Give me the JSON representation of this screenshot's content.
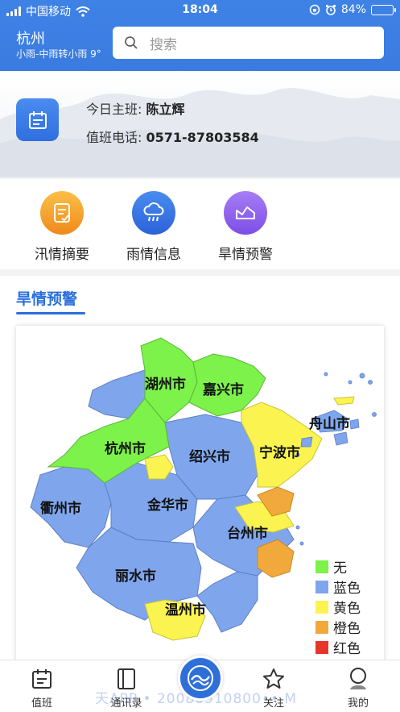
{
  "status_bar": {
    "carrier": "中国移动",
    "time": "18:04",
    "battery": "84%",
    "battery_level": 0.84
  },
  "header": {
    "city": "杭州",
    "weather": "小雨-中雨转小雨 9°",
    "search_placeholder": "搜索"
  },
  "duty": {
    "leader_label": "今日主班:",
    "leader_name": "陈立辉",
    "phone_label": "值班电话:",
    "phone": "0571-87803584"
  },
  "quick": [
    {
      "label": "汛情摘要",
      "color": "#f5a623"
    },
    {
      "label": "雨情信息",
      "color": "#2f6fe0"
    },
    {
      "label": "旱情预警",
      "color": "#8b5cf6"
    }
  ],
  "section": {
    "title": "旱情预警"
  },
  "map": {
    "cities": [
      "湖州市",
      "嘉兴市",
      "舟山市",
      "杭州市",
      "绍兴市",
      "宁波市",
      "衢州市",
      "金华市",
      "台州市",
      "丽水市",
      "温州市"
    ],
    "colors": {
      "none": "#7cf24a",
      "blue": "#7fa6ec",
      "yellow": "#fbf450",
      "orange": "#f2a93b",
      "red": "#e8352b"
    }
  },
  "legend": [
    {
      "label": "无",
      "color": "#7cf24a"
    },
    {
      "label": "蓝色",
      "color": "#7fa6ec"
    },
    {
      "label": "黄色",
      "color": "#fbf450"
    },
    {
      "label": "橙色",
      "color": "#f2a93b"
    },
    {
      "label": "红色",
      "color": "#e8352b"
    }
  ],
  "tabs": [
    {
      "label": "值班",
      "icon": "calendar-icon"
    },
    {
      "label": "通讯录",
      "icon": "contacts-icon"
    },
    {
      "label": "",
      "icon": "wave-logo-icon"
    },
    {
      "label": "关注",
      "icon": "star-icon"
    },
    {
      "label": "我的",
      "icon": "user-icon"
    }
  ],
  "watermark": "天APP • 20080910800•• M"
}
